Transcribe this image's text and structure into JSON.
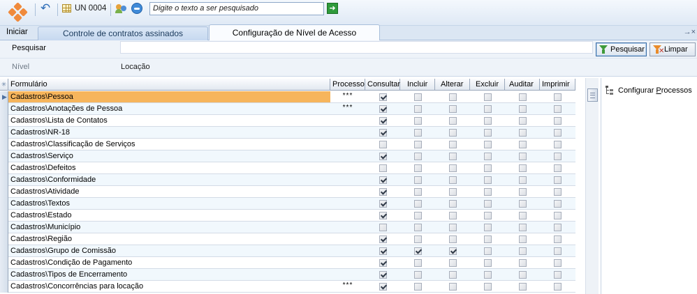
{
  "toolbar": {
    "unit_label": "UN 0004",
    "search_placeholder": "Digite o texto a ser pesquisado",
    "go_symbol": "➜"
  },
  "nav": {
    "start_label": "Iniciar",
    "tabs": [
      {
        "label": "Controle de contratos assinados",
        "active": false
      },
      {
        "label": "Configuração de Nível de Acesso",
        "active": true
      }
    ],
    "overflow_symbol": "→×"
  },
  "filter": {
    "search_label": "Pesquisar",
    "search_value": "",
    "search_button": "Pesquisar",
    "clear_button": "Limpar"
  },
  "info_row": {
    "level_label": "Nível",
    "location_label": "Locação"
  },
  "grid": {
    "columns": {
      "formulario": "Formulário",
      "processo": "Processo",
      "consultar": "Consultar",
      "incluir": "Incluir",
      "alterar": "Alterar",
      "excluir": "Excluir",
      "auditar": "Auditar",
      "imprimir": "Imprimir"
    },
    "rows": [
      {
        "form": "Cadastros\\Pessoa",
        "processo": "***",
        "consultar": true,
        "incluir": false,
        "alterar": false,
        "excluir": false,
        "auditar": false,
        "imprimir": false,
        "selected": true
      },
      {
        "form": "Cadastros\\Anotações de Pessoa",
        "processo": "***",
        "consultar": true,
        "incluir": false,
        "alterar": false,
        "excluir": false,
        "auditar": false,
        "imprimir": false
      },
      {
        "form": "Cadastros\\Lista de Contatos",
        "processo": "",
        "consultar": true,
        "incluir": false,
        "alterar": false,
        "excluir": false,
        "auditar": false,
        "imprimir": false
      },
      {
        "form": "Cadastros\\NR-18",
        "processo": "",
        "consultar": true,
        "incluir": false,
        "alterar": false,
        "excluir": false,
        "auditar": false,
        "imprimir": false
      },
      {
        "form": "Cadastros\\Classificação de Serviços",
        "processo": "",
        "consultar": false,
        "incluir": false,
        "alterar": false,
        "excluir": false,
        "auditar": false,
        "imprimir": false
      },
      {
        "form": "Cadastros\\Serviço",
        "processo": "",
        "consultar": true,
        "incluir": false,
        "alterar": false,
        "excluir": false,
        "auditar": false,
        "imprimir": false
      },
      {
        "form": "Cadastros\\Defeitos",
        "processo": "",
        "consultar": false,
        "incluir": false,
        "alterar": false,
        "excluir": false,
        "auditar": false,
        "imprimir": false
      },
      {
        "form": "Cadastros\\Conformidade",
        "processo": "",
        "consultar": true,
        "incluir": false,
        "alterar": false,
        "excluir": false,
        "auditar": false,
        "imprimir": false
      },
      {
        "form": "Cadastros\\Atividade",
        "processo": "",
        "consultar": true,
        "incluir": false,
        "alterar": false,
        "excluir": false,
        "auditar": false,
        "imprimir": false
      },
      {
        "form": "Cadastros\\Textos",
        "processo": "",
        "consultar": true,
        "incluir": false,
        "alterar": false,
        "excluir": false,
        "auditar": false,
        "imprimir": false
      },
      {
        "form": "Cadastros\\Estado",
        "processo": "",
        "consultar": true,
        "incluir": false,
        "alterar": false,
        "excluir": false,
        "auditar": false,
        "imprimir": false
      },
      {
        "form": "Cadastros\\Município",
        "processo": "",
        "consultar": false,
        "incluir": false,
        "alterar": false,
        "excluir": false,
        "auditar": false,
        "imprimir": false
      },
      {
        "form": "Cadastros\\Região",
        "processo": "",
        "consultar": true,
        "incluir": false,
        "alterar": false,
        "excluir": false,
        "auditar": false,
        "imprimir": false
      },
      {
        "form": "Cadastros\\Grupo de Comissão",
        "processo": "",
        "consultar": true,
        "incluir": true,
        "alterar": true,
        "excluir": false,
        "auditar": false,
        "imprimir": false
      },
      {
        "form": "Cadastros\\Condição de Pagamento",
        "processo": "",
        "consultar": true,
        "incluir": false,
        "alterar": false,
        "excluir": false,
        "auditar": false,
        "imprimir": false
      },
      {
        "form": "Cadastros\\Tipos de Encerramento",
        "processo": "",
        "consultar": true,
        "incluir": false,
        "alterar": false,
        "excluir": false,
        "auditar": false,
        "imprimir": false
      },
      {
        "form": "Cadastros\\Concorrências para locação",
        "processo": "***",
        "consultar": true,
        "incluir": false,
        "alterar": false,
        "excluir": false,
        "auditar": false,
        "imprimir": false
      }
    ]
  },
  "side_panel": {
    "tree_label_prefix": "Configurar ",
    "tree_label_underlined": "P",
    "tree_label_rest": "rocessos"
  }
}
